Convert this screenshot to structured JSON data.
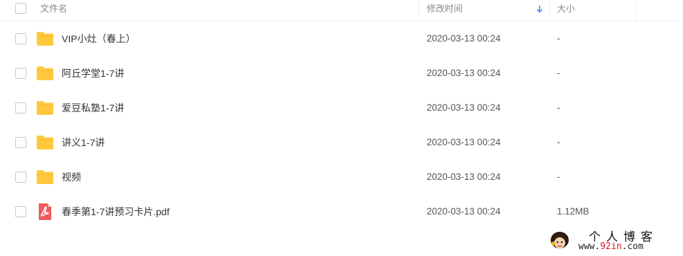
{
  "header": {
    "name_label": "文件名",
    "date_label": "修改时间",
    "size_label": "大小",
    "sort_icon": "arrow-down-icon"
  },
  "colors": {
    "folder": "#FFC83D",
    "pdf": "#F05A5A",
    "sort_arrow": "#3B8CFF"
  },
  "files": [
    {
      "type": "folder",
      "icon": "folder-icon",
      "name": "VIP小灶（春上）",
      "modified": "2020-03-13 00:24",
      "size": "-"
    },
    {
      "type": "folder",
      "icon": "folder-icon",
      "name": "阿丘学堂1-7讲",
      "modified": "2020-03-13 00:24",
      "size": "-"
    },
    {
      "type": "folder",
      "icon": "folder-icon",
      "name": "爱豆私塾1-7讲",
      "modified": "2020-03-13 00:24",
      "size": "-"
    },
    {
      "type": "folder",
      "icon": "folder-icon",
      "name": "讲义1-7讲",
      "modified": "2020-03-13 00:24",
      "size": "-"
    },
    {
      "type": "folder",
      "icon": "folder-icon",
      "name": "视频",
      "modified": "2020-03-13 00:24",
      "size": "-"
    },
    {
      "type": "pdf",
      "icon": "pdf-file-icon",
      "name": "春季第1-7讲预习卡片.pdf",
      "modified": "2020-03-13 00:24",
      "size": "1.12MB"
    }
  ],
  "watermark": {
    "title": "个人博客",
    "url_prefix": "www.",
    "url_highlight": "92in",
    "url_suffix": ".com"
  }
}
